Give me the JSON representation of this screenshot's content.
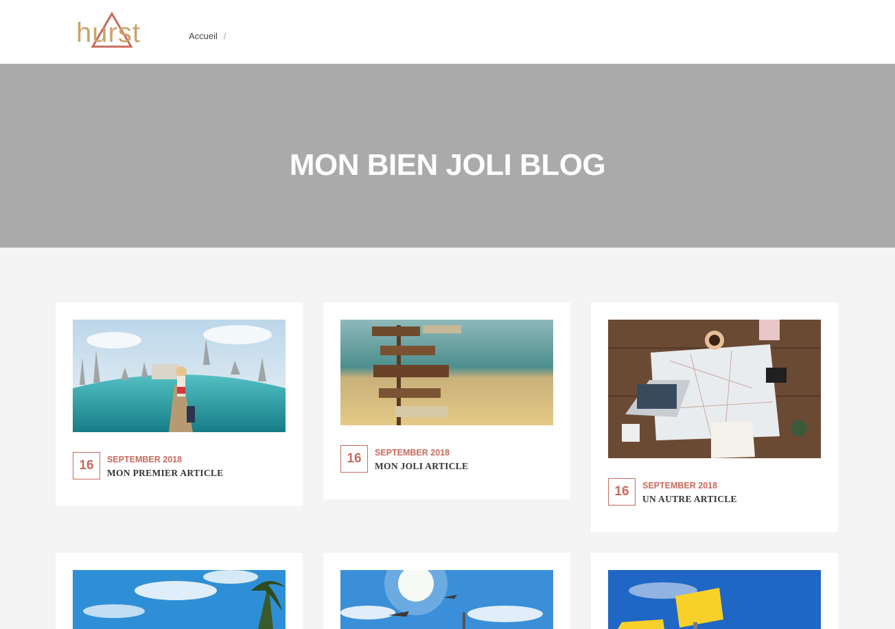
{
  "header": {
    "logo_text": "hurst",
    "breadcrumb": {
      "home_label": "Accueil",
      "separator": "/"
    }
  },
  "hero": {
    "title": "MON BIEN JOLI BLOG"
  },
  "colors": {
    "accent": "#c8695d",
    "logo": "#c9a46a",
    "hero_bg": "#aaaaaa",
    "page_bg": "#f4f4f4"
  },
  "posts": [
    {
      "day": "16",
      "month_year": "SEPTEMBER 2018",
      "title": "MON PREMIER ARTICLE",
      "image": "travel-woman-landmarks-image"
    },
    {
      "day": "16",
      "month_year": "SEPTEMBER 2018",
      "title": "MON JOLI ARTICLE",
      "image": "signpost-beach-image"
    },
    {
      "day": "16",
      "month_year": "SEPTEMBER 2018",
      "title": "UN AUTRE ARTICLE",
      "image": "map-laptop-desk-image"
    },
    {
      "image": "palm-beach-sky-image"
    },
    {
      "image": "sun-plane-sky-image"
    },
    {
      "image": "new-zealand-sign-image"
    }
  ]
}
